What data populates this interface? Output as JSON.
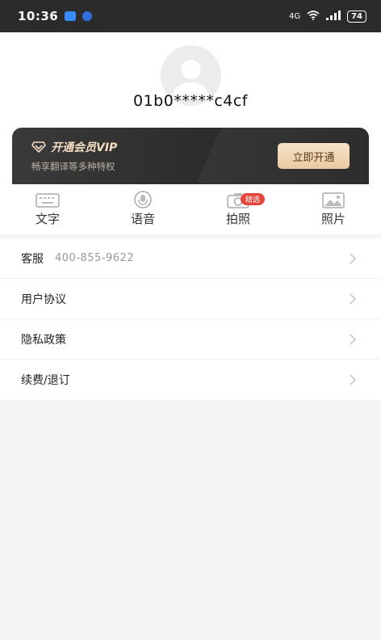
{
  "status_bar": {
    "time": "10:36",
    "network": "4G",
    "battery": "74"
  },
  "profile": {
    "user_id": "01b0*****c4cf"
  },
  "vip": {
    "title": "开通会员VIP",
    "subtitle": "畅享翻译等多种特权",
    "button_label": "立即开通"
  },
  "features": [
    {
      "label": "文字",
      "icon": "keyboard-icon"
    },
    {
      "label": "语音",
      "icon": "microphone-icon"
    },
    {
      "label": "拍照",
      "icon": "camera-icon",
      "badge": "精选"
    },
    {
      "label": "照片",
      "icon": "image-icon"
    }
  ],
  "menu": [
    {
      "label": "客服",
      "value": "400-855-9622"
    },
    {
      "label": "用户协议"
    },
    {
      "label": "隐私政策"
    },
    {
      "label": "续费/退订"
    }
  ],
  "colors": {
    "status_bar": "#2b2b2b",
    "vip_card": "#2c2c2c",
    "vip_gold": "#f3dcc0",
    "vip_button": "#eacaa3",
    "badge": "#e5453b",
    "background": "#f5f5f5"
  }
}
